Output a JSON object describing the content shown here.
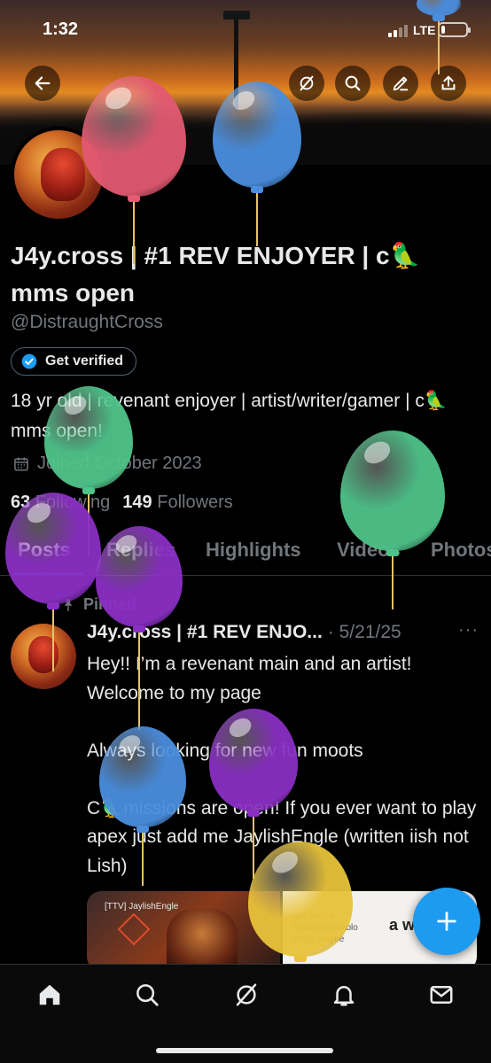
{
  "status_bar": {
    "time": "1:32",
    "network": "LTE"
  },
  "header": {
    "back_icon": "arrow-left-icon",
    "actions": [
      "grok-icon",
      "search-icon",
      "compose-icon",
      "share-icon"
    ]
  },
  "profile": {
    "display_name": "J4y.cross | #1 REV ENJOYER | c🦜mms open",
    "handle": "@DistraughtCross",
    "verify_label": "Get verified",
    "bio": "18 yr old | revenant enjoyer | artist/writer/gamer | c🦜mms open!",
    "joined": "Joined October 2023",
    "following_count": "63",
    "following_label": "Following",
    "followers_count": "149",
    "followers_label": "Followers"
  },
  "tabs": [
    "Posts",
    "Replies",
    "Highlights",
    "Videos",
    "Photos"
  ],
  "active_tab": "Posts",
  "pinned_post": {
    "pinned_label": "Pinned",
    "author": "J4y.cross | #1 REV ENJO...",
    "date": "· 5/21/25",
    "more": "···",
    "line1": "Hey!! I’m a revenant main and an artist! Welcome to my page",
    "line2": "Always looking for new fun moots",
    "line3": "C🦜missions are open! If you ever want to play apex just add me JaylishEngle (written iish not Lish)",
    "media1_caption": "[TTV] JaylishEngle",
    "media2_text": "um, you're\nfrankly scramblo\nengle maybe",
    "media2_big": "a w"
  },
  "bottom_nav": [
    "home-icon",
    "search-icon",
    "grok-icon",
    "notifications-icon",
    "messages-icon"
  ],
  "colors": {
    "accent": "#1d9bf0",
    "muted": "#71767b",
    "text": "#e7e9ea",
    "background": "#000000"
  },
  "balloon_colors": [
    "#e35a72",
    "#4a8ede",
    "#4fc48a",
    "#8a2fc4",
    "#4a8ede",
    "#e8c23a"
  ]
}
